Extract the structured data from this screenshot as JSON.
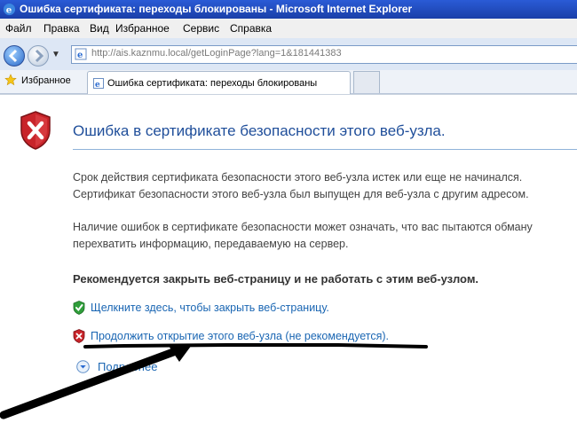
{
  "window": {
    "title": "Ошибка сертификата: переходы блокированы - Microsoft Internet Explorer"
  },
  "menu": {
    "items": [
      "Файл",
      "Правка",
      "Вид",
      "Избранное",
      "Сервис",
      "Справка"
    ]
  },
  "address": {
    "url": "http://ais.kaznmu.local/getLoginPage?lang=1&181441383",
    "icon": "ie-page-icon"
  },
  "favorites": {
    "label": "Избранное",
    "icon": "star-icon"
  },
  "tabs": [
    {
      "title": "Ошибка сертификата: переходы блокированы",
      "icon": "ie-page-icon"
    }
  ],
  "page": {
    "heading": "Ошибка в сертификате безопасности этого веб-узла.",
    "paragraph1": [
      "Срок действия сертификата безопасности этого веб-узла истек или еще не начинался.",
      "Сертификат безопасности этого веб-узла был выпущен для веб-узла с другим адресом."
    ],
    "paragraph2": [
      "Наличие ошибок в сертификате безопасности может означать, что вас пытаются обману",
      "перехватить информацию, передаваемую на сервер."
    ],
    "recommendation": "Рекомендуется закрыть веб-страницу и не работать с этим веб-узлом.",
    "close_link": "Щелкните здесь, чтобы закрыть веб-страницу.",
    "continue_link": "Продолжить открытие этого веб-узла (не рекомендуется).",
    "more_info": "Подробнее"
  },
  "colors": {
    "heading": "#1f4e9a",
    "link": "#1a66b3",
    "titlebar": "#1a3fa8"
  }
}
